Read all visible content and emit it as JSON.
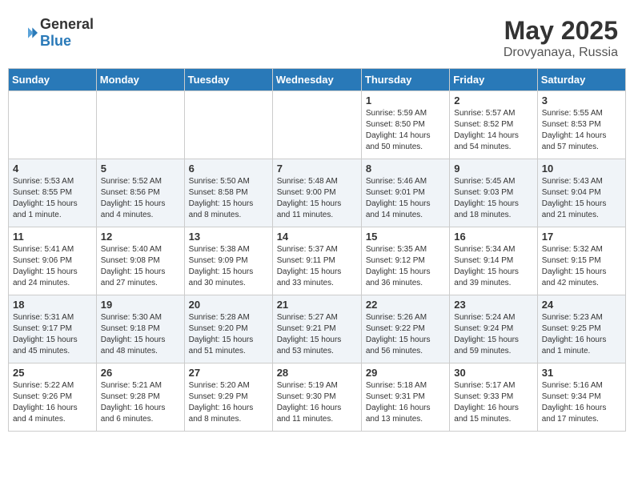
{
  "header": {
    "logo_general": "General",
    "logo_blue": "Blue",
    "month": "May 2025",
    "location": "Drovyanaya, Russia"
  },
  "weekdays": [
    "Sunday",
    "Monday",
    "Tuesday",
    "Wednesday",
    "Thursday",
    "Friday",
    "Saturday"
  ],
  "weeks": [
    [
      {
        "day": "",
        "info": ""
      },
      {
        "day": "",
        "info": ""
      },
      {
        "day": "",
        "info": ""
      },
      {
        "day": "",
        "info": ""
      },
      {
        "day": "1",
        "info": "Sunrise: 5:59 AM\nSunset: 8:50 PM\nDaylight: 14 hours\nand 50 minutes."
      },
      {
        "day": "2",
        "info": "Sunrise: 5:57 AM\nSunset: 8:52 PM\nDaylight: 14 hours\nand 54 minutes."
      },
      {
        "day": "3",
        "info": "Sunrise: 5:55 AM\nSunset: 8:53 PM\nDaylight: 14 hours\nand 57 minutes."
      }
    ],
    [
      {
        "day": "4",
        "info": "Sunrise: 5:53 AM\nSunset: 8:55 PM\nDaylight: 15 hours\nand 1 minute."
      },
      {
        "day": "5",
        "info": "Sunrise: 5:52 AM\nSunset: 8:56 PM\nDaylight: 15 hours\nand 4 minutes."
      },
      {
        "day": "6",
        "info": "Sunrise: 5:50 AM\nSunset: 8:58 PM\nDaylight: 15 hours\nand 8 minutes."
      },
      {
        "day": "7",
        "info": "Sunrise: 5:48 AM\nSunset: 9:00 PM\nDaylight: 15 hours\nand 11 minutes."
      },
      {
        "day": "8",
        "info": "Sunrise: 5:46 AM\nSunset: 9:01 PM\nDaylight: 15 hours\nand 14 minutes."
      },
      {
        "day": "9",
        "info": "Sunrise: 5:45 AM\nSunset: 9:03 PM\nDaylight: 15 hours\nand 18 minutes."
      },
      {
        "day": "10",
        "info": "Sunrise: 5:43 AM\nSunset: 9:04 PM\nDaylight: 15 hours\nand 21 minutes."
      }
    ],
    [
      {
        "day": "11",
        "info": "Sunrise: 5:41 AM\nSunset: 9:06 PM\nDaylight: 15 hours\nand 24 minutes."
      },
      {
        "day": "12",
        "info": "Sunrise: 5:40 AM\nSunset: 9:08 PM\nDaylight: 15 hours\nand 27 minutes."
      },
      {
        "day": "13",
        "info": "Sunrise: 5:38 AM\nSunset: 9:09 PM\nDaylight: 15 hours\nand 30 minutes."
      },
      {
        "day": "14",
        "info": "Sunrise: 5:37 AM\nSunset: 9:11 PM\nDaylight: 15 hours\nand 33 minutes."
      },
      {
        "day": "15",
        "info": "Sunrise: 5:35 AM\nSunset: 9:12 PM\nDaylight: 15 hours\nand 36 minutes."
      },
      {
        "day": "16",
        "info": "Sunrise: 5:34 AM\nSunset: 9:14 PM\nDaylight: 15 hours\nand 39 minutes."
      },
      {
        "day": "17",
        "info": "Sunrise: 5:32 AM\nSunset: 9:15 PM\nDaylight: 15 hours\nand 42 minutes."
      }
    ],
    [
      {
        "day": "18",
        "info": "Sunrise: 5:31 AM\nSunset: 9:17 PM\nDaylight: 15 hours\nand 45 minutes."
      },
      {
        "day": "19",
        "info": "Sunrise: 5:30 AM\nSunset: 9:18 PM\nDaylight: 15 hours\nand 48 minutes."
      },
      {
        "day": "20",
        "info": "Sunrise: 5:28 AM\nSunset: 9:20 PM\nDaylight: 15 hours\nand 51 minutes."
      },
      {
        "day": "21",
        "info": "Sunrise: 5:27 AM\nSunset: 9:21 PM\nDaylight: 15 hours\nand 53 minutes."
      },
      {
        "day": "22",
        "info": "Sunrise: 5:26 AM\nSunset: 9:22 PM\nDaylight: 15 hours\nand 56 minutes."
      },
      {
        "day": "23",
        "info": "Sunrise: 5:24 AM\nSunset: 9:24 PM\nDaylight: 15 hours\nand 59 minutes."
      },
      {
        "day": "24",
        "info": "Sunrise: 5:23 AM\nSunset: 9:25 PM\nDaylight: 16 hours\nand 1 minute."
      }
    ],
    [
      {
        "day": "25",
        "info": "Sunrise: 5:22 AM\nSunset: 9:26 PM\nDaylight: 16 hours\nand 4 minutes."
      },
      {
        "day": "26",
        "info": "Sunrise: 5:21 AM\nSunset: 9:28 PM\nDaylight: 16 hours\nand 6 minutes."
      },
      {
        "day": "27",
        "info": "Sunrise: 5:20 AM\nSunset: 9:29 PM\nDaylight: 16 hours\nand 8 minutes."
      },
      {
        "day": "28",
        "info": "Sunrise: 5:19 AM\nSunset: 9:30 PM\nDaylight: 16 hours\nand 11 minutes."
      },
      {
        "day": "29",
        "info": "Sunrise: 5:18 AM\nSunset: 9:31 PM\nDaylight: 16 hours\nand 13 minutes."
      },
      {
        "day": "30",
        "info": "Sunrise: 5:17 AM\nSunset: 9:33 PM\nDaylight: 16 hours\nand 15 minutes."
      },
      {
        "day": "31",
        "info": "Sunrise: 5:16 AM\nSunset: 9:34 PM\nDaylight: 16 hours\nand 17 minutes."
      }
    ]
  ]
}
